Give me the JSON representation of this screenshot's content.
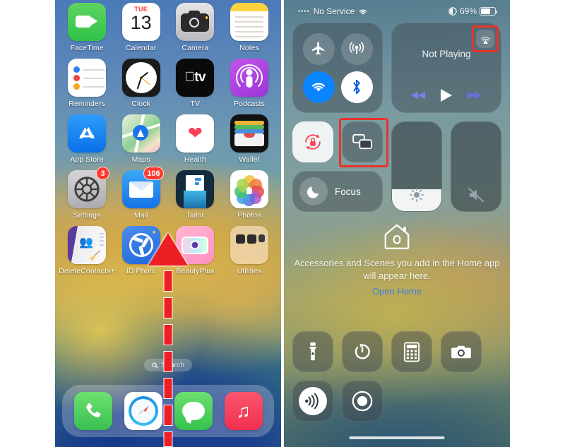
{
  "home_screen": {
    "rows": [
      [
        {
          "name": "FaceTime",
          "icon": "facetime-icon",
          "badge": null
        },
        {
          "name": "Calendar",
          "icon": "calendar-icon",
          "badge": null,
          "day": "TUE",
          "date": "13"
        },
        {
          "name": "Camera",
          "icon": "camera-icon",
          "badge": null
        },
        {
          "name": "Notes",
          "icon": "notes-icon",
          "badge": null
        }
      ],
      [
        {
          "name": "Reminders",
          "icon": "reminders-icon",
          "badge": null
        },
        {
          "name": "Clock",
          "icon": "clock-icon",
          "badge": null
        },
        {
          "name": "TV",
          "icon": "tv-icon",
          "badge": null,
          "glyph": "tv"
        },
        {
          "name": "Podcasts",
          "icon": "podcasts-icon",
          "badge": null
        }
      ],
      [
        {
          "name": "App Store",
          "icon": "app-store-icon",
          "badge": null
        },
        {
          "name": "Maps",
          "icon": "maps-icon",
          "badge": null
        },
        {
          "name": "Health",
          "icon": "health-icon",
          "badge": null
        },
        {
          "name": "Wallet",
          "icon": "wallet-icon",
          "badge": null
        }
      ],
      [
        {
          "name": "Settings",
          "icon": "settings-icon",
          "badge": "3"
        },
        {
          "name": "Mail",
          "icon": "mail-icon",
          "badge": "106"
        },
        {
          "name": "Tailor",
          "icon": "tailor-icon",
          "badge": null
        },
        {
          "name": "Photos",
          "icon": "photos-icon",
          "badge": null
        }
      ],
      [
        {
          "name": "DeleteContacts+",
          "icon": "deletecontacts-icon",
          "badge": null
        },
        {
          "name": "ID Photo",
          "icon": "id-photo-icon",
          "badge": null
        },
        {
          "name": "BeautyPlus",
          "icon": "beautyplus-icon",
          "badge": null
        },
        {
          "name": "Utilities",
          "icon": "utilities-folder-icon",
          "badge": null
        }
      ]
    ],
    "search": {
      "label": "Search",
      "icon": "search-icon"
    },
    "dock": [
      {
        "name": "Phone",
        "icon": "phone-icon"
      },
      {
        "name": "Safari",
        "icon": "safari-icon"
      },
      {
        "name": "Messages",
        "icon": "messages-icon"
      },
      {
        "name": "Music",
        "icon": "music-icon"
      }
    ],
    "gesture": {
      "name": "swipe-up-arrow",
      "color": "#ee1f24",
      "direction": "up"
    }
  },
  "control_center": {
    "status_bar": {
      "carrier": "No Service",
      "signal_dots": "••••",
      "wifi_icon": "wifi-icon",
      "focus_icon": "focus-indicator-icon",
      "battery_percent": "69%",
      "battery_level": 69
    },
    "connectivity": {
      "airplane": {
        "label": "Airplane Mode",
        "icon": "airplane-icon",
        "state": "off"
      },
      "cellular": {
        "label": "Cellular Data",
        "icon": "cellular-icon",
        "state": "off"
      },
      "wifi": {
        "label": "Wi-Fi",
        "icon": "wifi-icon",
        "state": "on",
        "color": "#0a84ff"
      },
      "bluetooth": {
        "label": "Bluetooth",
        "icon": "bluetooth-icon",
        "state": "on",
        "color": "#ffffff"
      }
    },
    "media": {
      "title": "Not Playing",
      "airplay_icon": "airplay-icon",
      "airplay_highlighted": true,
      "controls": [
        {
          "name": "rewind",
          "icon": "rewind-icon"
        },
        {
          "name": "play",
          "icon": "play-icon"
        },
        {
          "name": "forward",
          "icon": "fast-forward-icon"
        }
      ]
    },
    "rotation_lock": {
      "label": "Rotation Lock",
      "icon": "rotation-lock-icon",
      "state": "on",
      "color": "#fc4255"
    },
    "screen_mirroring": {
      "label": "Screen Mirroring",
      "icon": "screen-mirroring-icon",
      "highlighted": true
    },
    "focus": {
      "label": "Focus",
      "icon": "moon-icon"
    },
    "brightness": {
      "label": "Brightness",
      "icon": "brightness-icon",
      "value": 25
    },
    "volume": {
      "label": "Volume",
      "icon": "speaker-mute-icon",
      "value": 0,
      "muted": true
    },
    "home": {
      "icon": "home-house-icon",
      "message": "Accessories and Scenes you add in the Home app will appear here.",
      "link": "Open Home"
    },
    "utilities": [
      {
        "name": "Flashlight",
        "icon": "flashlight-icon"
      },
      {
        "name": "Timer",
        "icon": "timer-icon"
      },
      {
        "name": "Calculator",
        "icon": "calculator-icon"
      },
      {
        "name": "Camera",
        "icon": "camera-icon"
      },
      {
        "name": "Hearing",
        "icon": "hearing-icon"
      },
      {
        "name": "Screen Recording",
        "icon": "screen-record-icon"
      }
    ]
  },
  "highlight_color": "#e8332a"
}
